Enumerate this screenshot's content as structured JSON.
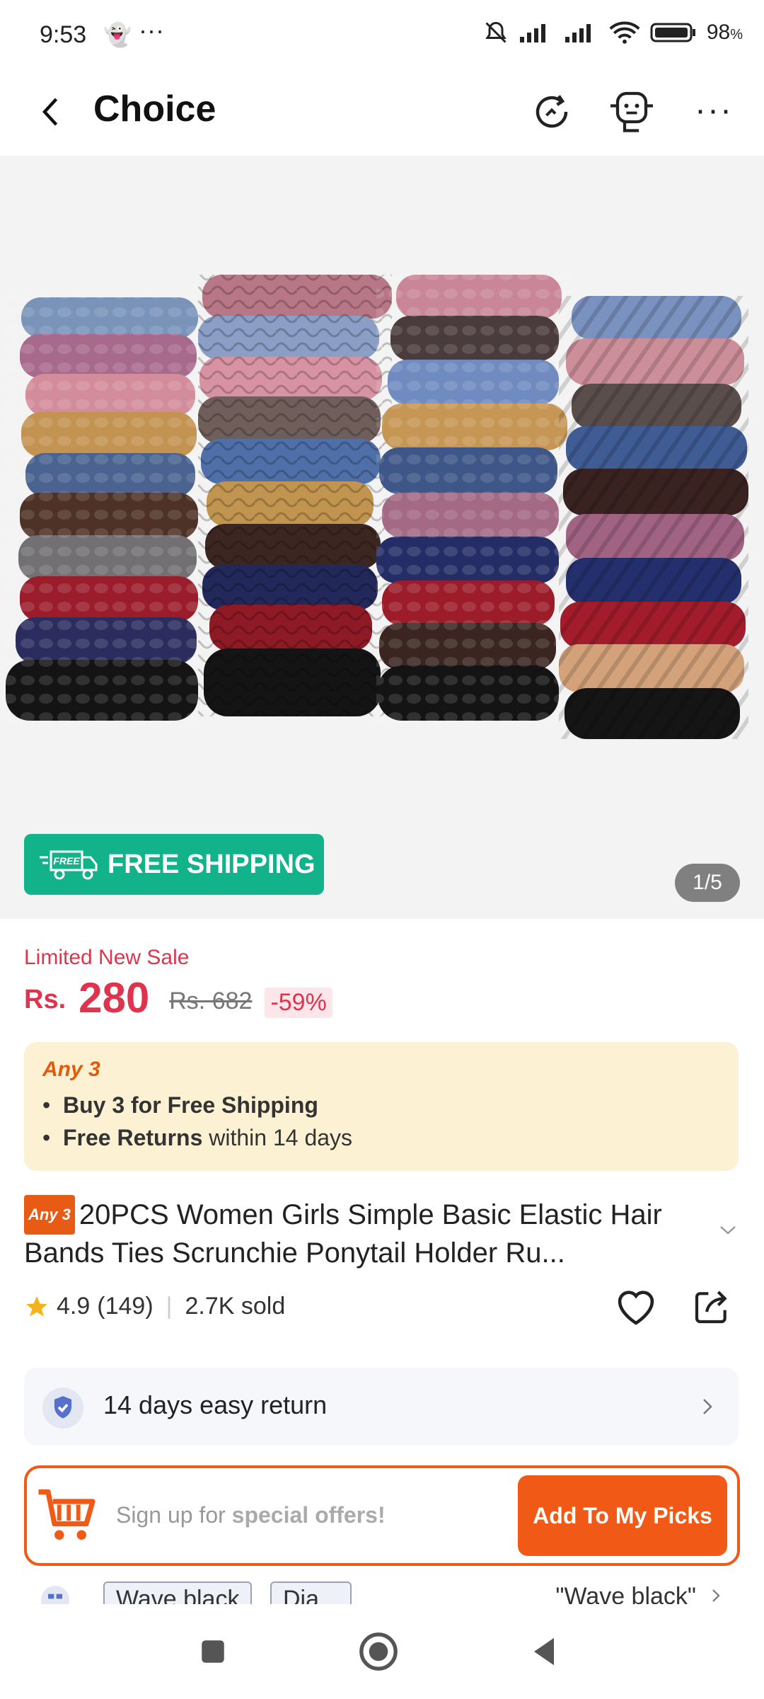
{
  "status_bar": {
    "time": "9:53",
    "battery": "98"
  },
  "header": {
    "title": "Choice"
  },
  "hero": {
    "free_shipping_label": "FREE SHIPPING",
    "free_badge": "FREE",
    "image_counter": "1/5"
  },
  "price": {
    "sale_label": "Limited New Sale",
    "currency": "Rs.",
    "amount": "280",
    "original": "Rs. 682",
    "discount": "-59%"
  },
  "promo": {
    "heading": "Any 3",
    "line1_bold": "Buy 3 for  Free Shipping",
    "line2_bold": "Free Returns",
    "line2_rest": " within 14 days"
  },
  "product": {
    "tag": "Any 3",
    "title": "20PCS Women Girls Simple Basic Elastic Hair Bands Ties Scrunchie Ponytail Holder Ru..."
  },
  "rating": {
    "score": "4.9",
    "count": "(149)",
    "sold": "2.7K sold"
  },
  "returns": {
    "label": "14 days easy return"
  },
  "offer": {
    "text_prefix": "Sign up for ",
    "text_bold": "special offers!",
    "button_label": "Add To My Picks"
  },
  "variants": {
    "chip1": "Wave black",
    "chip2": "Dia...",
    "selected": "\"Wave black\""
  },
  "colors": {
    "accent_orange": "#f05a16",
    "price_red": "#e0344e",
    "free_shipping_green": "#12b28a"
  }
}
